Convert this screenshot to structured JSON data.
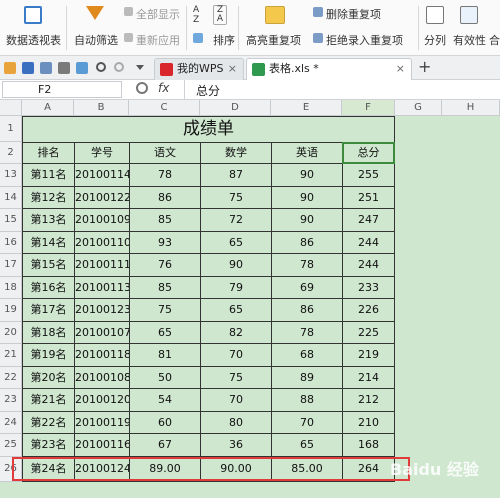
{
  "toolbar": {
    "pivot": "数据透视表",
    "autofilter": "自动筛选",
    "show_all": "全部显示",
    "reapply": "重新应用",
    "sort": "排序",
    "highlight_dup": "高亮重复项",
    "remove_dup": "删除重复项",
    "reject_dup": "拒绝录入重复项",
    "split": "分列",
    "validity": "有效性",
    "more": "合"
  },
  "tabs": [
    {
      "label": "我的WPS"
    },
    {
      "label": "表格.xls *"
    }
  ],
  "formula": {
    "cell_ref": "F2",
    "fx": "fx",
    "value": "总分"
  },
  "sheet": {
    "columns": [
      "A",
      "B",
      "C",
      "D",
      "E",
      "F",
      "G",
      "H"
    ],
    "title": "成绩单",
    "headers": [
      "排名",
      "学号",
      "语文",
      "数学",
      "英语",
      "总分"
    ],
    "rows": [
      {
        "n": "13",
        "c": [
          "第11名",
          "20100114",
          "78",
          "87",
          "90",
          "255"
        ]
      },
      {
        "n": "14",
        "c": [
          "第12名",
          "20100122",
          "86",
          "75",
          "90",
          "251"
        ]
      },
      {
        "n": "15",
        "c": [
          "第13名",
          "20100109",
          "85",
          "72",
          "90",
          "247"
        ]
      },
      {
        "n": "16",
        "c": [
          "第14名",
          "20100110",
          "93",
          "65",
          "86",
          "244"
        ]
      },
      {
        "n": "17",
        "c": [
          "第15名",
          "20100111",
          "76",
          "90",
          "78",
          "244"
        ]
      },
      {
        "n": "18",
        "c": [
          "第16名",
          "20100113",
          "85",
          "79",
          "69",
          "233"
        ]
      },
      {
        "n": "19",
        "c": [
          "第17名",
          "20100123",
          "75",
          "65",
          "86",
          "226"
        ]
      },
      {
        "n": "20",
        "c": [
          "第18名",
          "20100107",
          "65",
          "82",
          "78",
          "225"
        ]
      },
      {
        "n": "21",
        "c": [
          "第19名",
          "20100118",
          "81",
          "70",
          "68",
          "219"
        ]
      },
      {
        "n": "22",
        "c": [
          "第20名",
          "20100108",
          "50",
          "75",
          "89",
          "214"
        ]
      },
      {
        "n": "23",
        "c": [
          "第21名",
          "20100120",
          "54",
          "70",
          "88",
          "212"
        ]
      },
      {
        "n": "24",
        "c": [
          "第22名",
          "20100119",
          "60",
          "80",
          "70",
          "210"
        ]
      },
      {
        "n": "25",
        "c": [
          "第23名",
          "20100116",
          "67",
          "36",
          "65",
          "168"
        ]
      },
      {
        "n": "26",
        "c": [
          "第24名",
          "20100124",
          "89.00",
          "90.00",
          "85.00",
          "264"
        ]
      }
    ],
    "row1_num": "1",
    "row2_num": "2"
  },
  "watermark": "Baidu 经验",
  "colors": {
    "cell_bg": "#cfe6cf",
    "highlight_box": "#e03a3a",
    "selected_border": "#3c8a3c"
  }
}
